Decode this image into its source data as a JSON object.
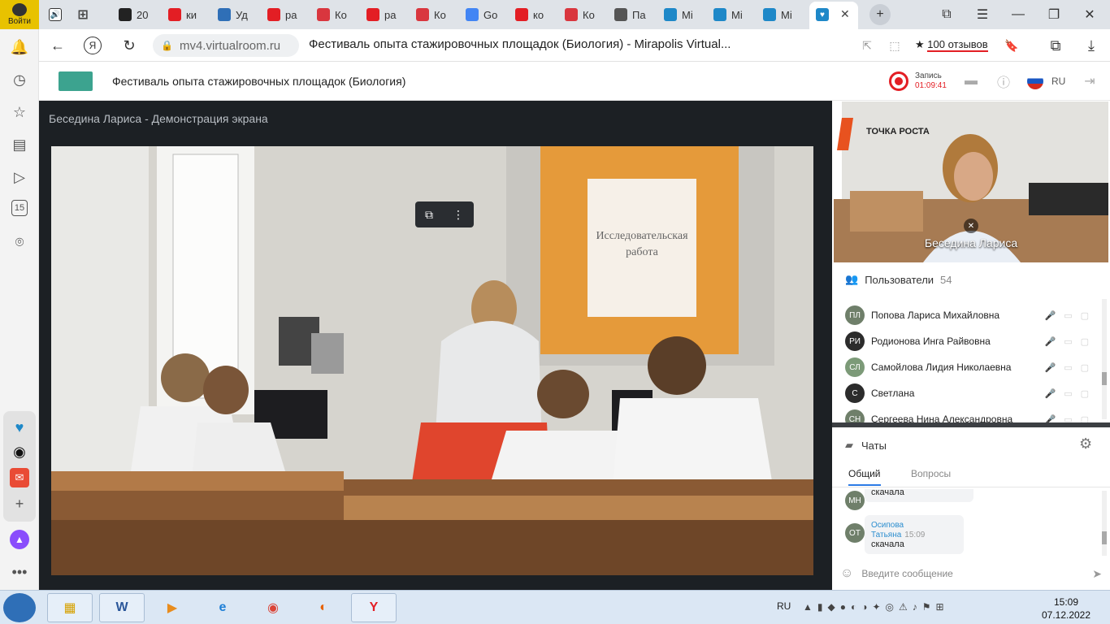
{
  "browser": {
    "login_label": "Войти",
    "tabs": [
      {
        "label": "20",
        "color": "#222"
      },
      {
        "label": "ки",
        "color": "#e31e24"
      },
      {
        "label": "Уд",
        "color": "#2f6fb7"
      },
      {
        "label": "ра",
        "color": "#e31e24"
      },
      {
        "label": "Ко",
        "color": "#d9363e"
      },
      {
        "label": "ра",
        "color": "#e31e24"
      },
      {
        "label": "Ко",
        "color": "#d9363e"
      },
      {
        "label": "Go",
        "color": "#4285f4"
      },
      {
        "label": "ко",
        "color": "#e31e24"
      },
      {
        "label": "Ко",
        "color": "#d9363e"
      },
      {
        "label": "Па",
        "color": "#555"
      },
      {
        "label": "Mi",
        "color": "#1e88c8"
      },
      {
        "label": "Mi",
        "color": "#1e88c8"
      },
      {
        "label": "Mi",
        "color": "#1e88c8"
      }
    ],
    "url": "mv4.virtualroom.ru",
    "page_title": "Фестиваль опыта стажировочных площадок (Биология) - Mirapolis Virtual...",
    "reviews": "100 отзывов"
  },
  "sidebar": {
    "badge": "15"
  },
  "app": {
    "title": "Фестиваль опыта стажировочных площадок (Биология)",
    "record_label": "Запись",
    "record_time": "01:09:41",
    "language": "RU"
  },
  "stage": {
    "title": "Беседина Лариса - Демонстрация экрана",
    "slide_text_line1": "Исследовательская",
    "slide_text_line2": "работа",
    "wall_sign": "ТОЧКА РОСТА"
  },
  "camera": {
    "name": "Беседина Лариса",
    "sign": "ТОЧКА РОСТА"
  },
  "users": {
    "title": "Пользователи",
    "count": "54",
    "list": [
      {
        "initials": "ПЛ",
        "name": "Попова Лариса Михайловна",
        "color": "#6f7f6a"
      },
      {
        "initials": "РИ",
        "name": "Родионова Инга Райвовна",
        "color": "#2c2c2c"
      },
      {
        "initials": "СЛ",
        "name": "Самойлова Лидия Николаевна",
        "color": "#7c9a78"
      },
      {
        "initials": "С",
        "name": "Светлана",
        "color": "#2c2c2c"
      },
      {
        "initials": "СН",
        "name": "Сергеева Нина Александровна",
        "color": "#6f7f6a"
      }
    ]
  },
  "chat": {
    "title": "Чаты",
    "tab_general": "Общий",
    "tab_questions": "Вопросы",
    "messages": [
      {
        "initials": "МН",
        "name": "",
        "time": "",
        "text": "скачала"
      },
      {
        "initials": "ОТ",
        "name": "Осипова Татьяна",
        "time": "15:09",
        "text": "скачала"
      }
    ],
    "input_placeholder": "Введите сообщение"
  },
  "taskbar": {
    "lang": "RU",
    "time": "15:09",
    "date": "07.12.2022"
  }
}
